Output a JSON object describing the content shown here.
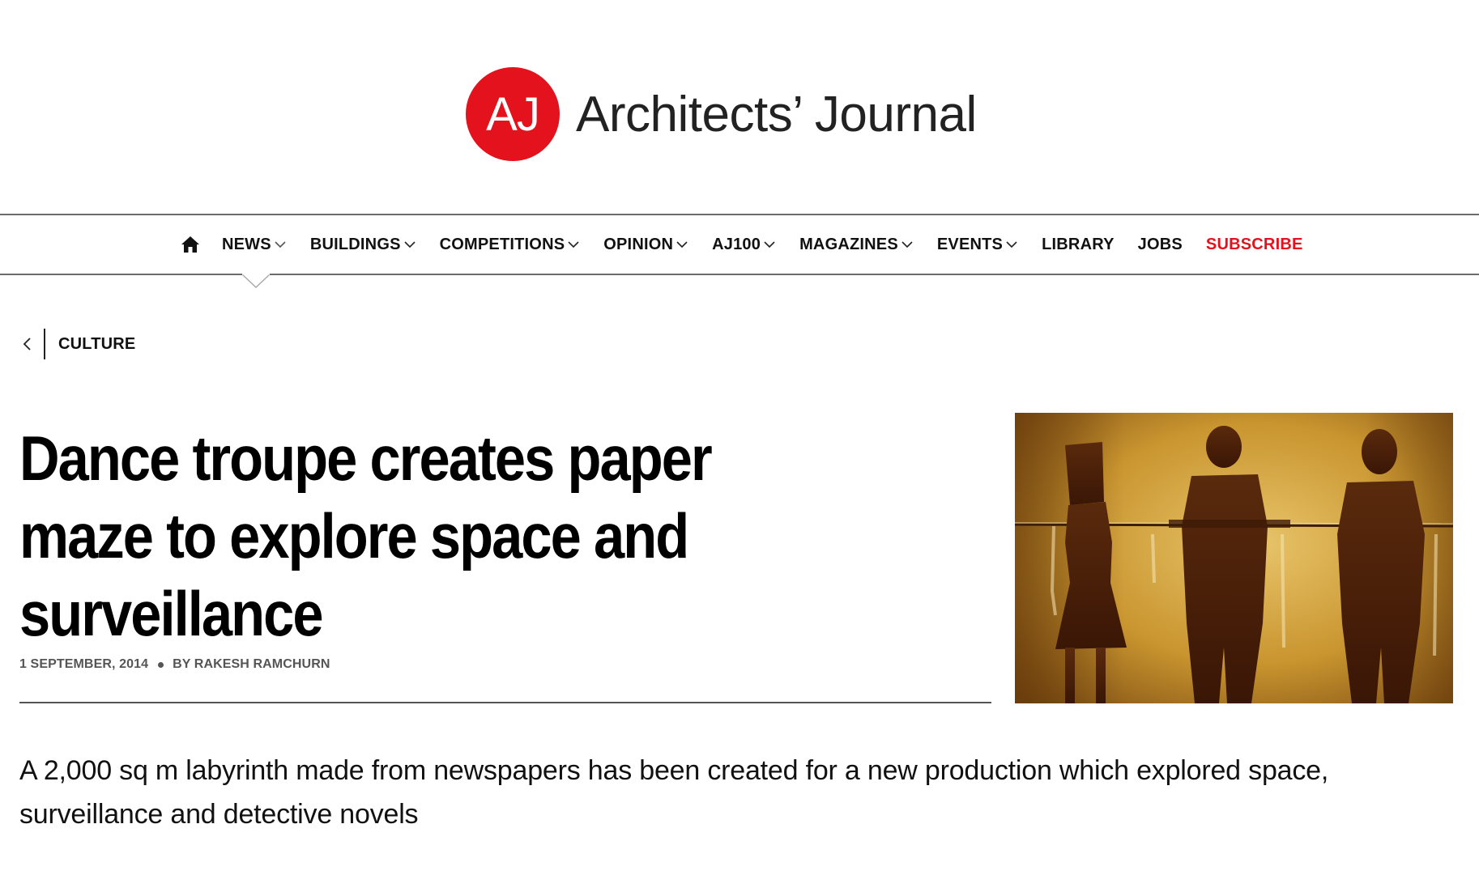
{
  "brand": {
    "mark": "AJ",
    "name": "Architects’ Journal",
    "color": "#e3121c"
  },
  "nav": {
    "home_icon": "home-icon",
    "items": [
      {
        "label": "NEWS",
        "has_dropdown": true
      },
      {
        "label": "BUILDINGS",
        "has_dropdown": true
      },
      {
        "label": "COMPETITIONS",
        "has_dropdown": true
      },
      {
        "label": "OPINION",
        "has_dropdown": true
      },
      {
        "label": "AJ100",
        "has_dropdown": true
      },
      {
        "label": "MAGAZINES",
        "has_dropdown": true
      },
      {
        "label": "EVENTS",
        "has_dropdown": true
      },
      {
        "label": "LIBRARY",
        "has_dropdown": false
      },
      {
        "label": "JOBS",
        "has_dropdown": false
      }
    ],
    "subscribe": {
      "label": "SUBSCRIBE",
      "color": "#e3121c"
    }
  },
  "breadcrumb": {
    "back_icon": "chevron-left-icon",
    "section": "CULTURE"
  },
  "article": {
    "headline": "Dance troupe creates paper maze to explore space and surveillance",
    "date": "1 SEPTEMBER, 2014",
    "byline": "BY RAKESH RAMCHURN",
    "standfirst": "A 2,000 sq m labyrinth made from newspapers has been created for a new production which explored space, surveillance and detective novels"
  }
}
